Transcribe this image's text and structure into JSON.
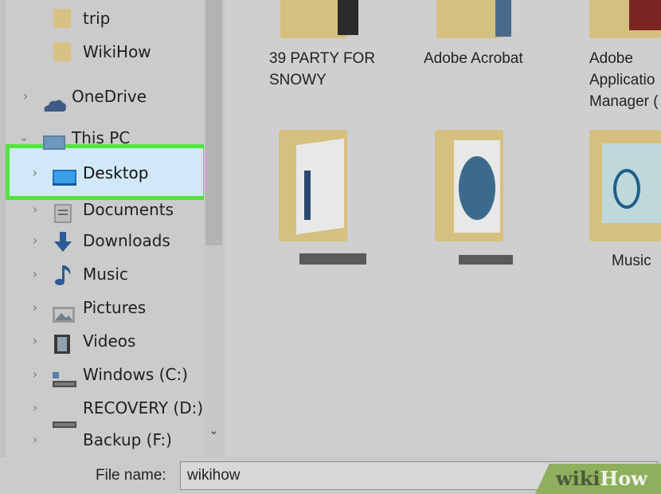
{
  "nav": {
    "items": [
      {
        "label": "trip",
        "icon": "folder-icon",
        "chevron": ""
      },
      {
        "label": "WikiHow",
        "icon": "folder-icon",
        "chevron": ""
      },
      {
        "label": "OneDrive",
        "icon": "onedrive-icon",
        "chevron": ">"
      },
      {
        "label": "This PC",
        "icon": "computer-icon",
        "chevron": "v"
      },
      {
        "label": "Desktop",
        "icon": "desktop-icon",
        "chevron": ">"
      },
      {
        "label": "Documents",
        "icon": "documents-icon",
        "chevron": ">"
      },
      {
        "label": "Downloads",
        "icon": "downloads-icon",
        "chevron": ">"
      },
      {
        "label": "Music",
        "icon": "music-icon",
        "chevron": ">"
      },
      {
        "label": "Pictures",
        "icon": "pictures-icon",
        "chevron": ">"
      },
      {
        "label": "Videos",
        "icon": "videos-icon",
        "chevron": ">"
      },
      {
        "label": "Windows (C:)",
        "icon": "drive-c-icon",
        "chevron": ">"
      },
      {
        "label": "RECOVERY (D:)",
        "icon": "drive-icon",
        "chevron": ">"
      },
      {
        "label": "Backup (F:)",
        "icon": "drive-icon",
        "chevron": ">"
      }
    ],
    "scroll_down_glyph": "⌄"
  },
  "content": {
    "tiles": [
      {
        "label_line1": "39 PARTY FOR",
        "label_line2": "SNOWY"
      },
      {
        "label_line1": "Adobe Acrobat",
        "label_line2": ""
      },
      {
        "label_line1": "Adobe",
        "label_line2": "Applicatio",
        "label_line3": "Manager (",
        "truncated": true
      },
      {
        "label_line1": "",
        "label_line2": ""
      },
      {
        "label_line1": "",
        "label_line2": ""
      },
      {
        "label_line1": "Music",
        "label_line2": ""
      }
    ]
  },
  "footer": {
    "file_name_label": "File name:",
    "file_name_value": "wikihow"
  },
  "watermark": {
    "wiki": "wiki",
    "how": "How"
  },
  "colors": {
    "highlight_border": "#52e53d",
    "folder": "#d6c07f"
  }
}
